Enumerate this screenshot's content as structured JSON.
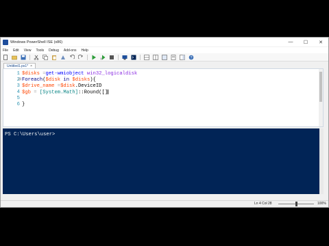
{
  "window": {
    "title": "Windows PowerShell ISE (x86)",
    "controls": {
      "minimize": "—",
      "maximize": "☐",
      "close": "✕"
    }
  },
  "menu": [
    "File",
    "Edit",
    "View",
    "Tools",
    "Debug",
    "Add-ons",
    "Help"
  ],
  "toolbar": {
    "icons": [
      "new-file-icon",
      "open-file-icon",
      "save-icon",
      "cut-icon",
      "copy-icon",
      "paste-icon",
      "clear-icon",
      "undo-icon",
      "redo-icon",
      "run-icon",
      "run-selection-icon",
      "stop-icon",
      "remote-powershell-icon",
      "console-icon",
      "layout-top-icon",
      "layout-right-icon",
      "layout-max-icon",
      "show-script-icon",
      "show-addons-icon",
      "help-icon"
    ]
  },
  "tab": {
    "label": "Untitled1.ps1*",
    "close": "×"
  },
  "editor": {
    "line_numbers": [
      "1",
      "2",
      "3",
      "4",
      "5",
      "6"
    ],
    "line1": {
      "var": "$disks",
      "eq": " =",
      "cmd": "get-wmiobject",
      "arg": " win32_logicaldisk"
    },
    "line2": {
      "kw": "Foreach",
      "p1": "(",
      "var1": "$disk",
      "in": " in ",
      "var2": "$disks",
      "p2": "){"
    },
    "line3": {
      "var": "$drive_name",
      "eq": " =",
      "var2": "$disk",
      "mem": ".DeviceID"
    },
    "line4": {
      "var": "$gb",
      "eq": " = ",
      "type": "[System.Math]",
      "mem": "::Round(",
      "bracket": "[]"
    },
    "line5": "",
    "line6": "}"
  },
  "console": {
    "prompt": "PS C:\\Users\\user>"
  },
  "status": {
    "position": "Ln 4  Col 28",
    "zoom": "100%",
    "zoom_fraction": 0.5
  }
}
